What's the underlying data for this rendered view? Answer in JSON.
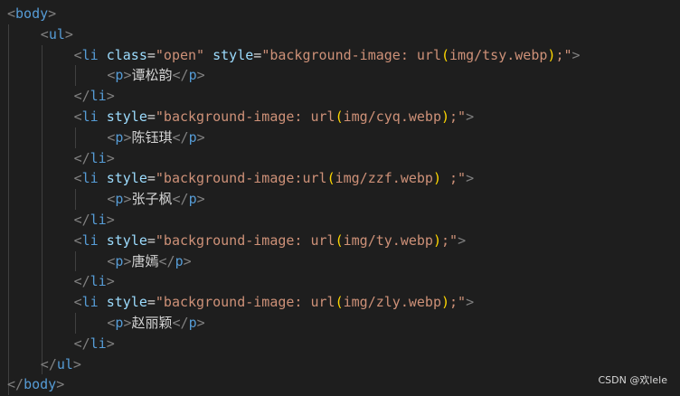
{
  "code": [
    {
      "indent": 0,
      "tokens": [
        [
          "punc",
          "<"
        ],
        [
          "tag",
          "body"
        ],
        [
          "punc",
          ">"
        ]
      ]
    },
    {
      "indent": 1,
      "tokens": [
        [
          "punc",
          "<"
        ],
        [
          "tag",
          "ul"
        ],
        [
          "punc",
          ">"
        ]
      ]
    },
    {
      "indent": 2,
      "tokens": [
        [
          "punc",
          "<"
        ],
        [
          "tag",
          "li"
        ],
        [
          "text",
          " "
        ],
        [
          "attr",
          "class"
        ],
        [
          "eq",
          "="
        ],
        [
          "str",
          "\"open\""
        ],
        [
          "text",
          " "
        ],
        [
          "attr",
          "style"
        ],
        [
          "eq",
          "="
        ],
        [
          "str",
          "\"background-image: url"
        ],
        [
          "brk",
          "("
        ],
        [
          "str",
          "img/tsy.webp"
        ],
        [
          "brk",
          ")"
        ],
        [
          "str",
          ";\""
        ],
        [
          "punc",
          ">"
        ]
      ]
    },
    {
      "indent": 3,
      "tokens": [
        [
          "punc",
          "<"
        ],
        [
          "tag",
          "p"
        ],
        [
          "punc",
          ">"
        ],
        [
          "text",
          "谭松韵"
        ],
        [
          "punc",
          "</"
        ],
        [
          "tag",
          "p"
        ],
        [
          "punc",
          ">"
        ]
      ]
    },
    {
      "indent": 2,
      "tokens": [
        [
          "punc",
          "</"
        ],
        [
          "tag",
          "li"
        ],
        [
          "punc",
          ">"
        ]
      ]
    },
    {
      "indent": 2,
      "tokens": [
        [
          "punc",
          "<"
        ],
        [
          "tag",
          "li"
        ],
        [
          "text",
          " "
        ],
        [
          "attr",
          "style"
        ],
        [
          "eq",
          "="
        ],
        [
          "str",
          "\"background-image: url"
        ],
        [
          "brk",
          "("
        ],
        [
          "str",
          "img/cyq.webp"
        ],
        [
          "brk",
          ")"
        ],
        [
          "str",
          ";\""
        ],
        [
          "punc",
          ">"
        ]
      ]
    },
    {
      "indent": 3,
      "tokens": [
        [
          "punc",
          "<"
        ],
        [
          "tag",
          "p"
        ],
        [
          "punc",
          ">"
        ],
        [
          "text",
          "陈钰琪"
        ],
        [
          "punc",
          "</"
        ],
        [
          "tag",
          "p"
        ],
        [
          "punc",
          ">"
        ]
      ]
    },
    {
      "indent": 2,
      "tokens": [
        [
          "punc",
          "</"
        ],
        [
          "tag",
          "li"
        ],
        [
          "punc",
          ">"
        ]
      ]
    },
    {
      "indent": 2,
      "tokens": [
        [
          "punc",
          "<"
        ],
        [
          "tag",
          "li"
        ],
        [
          "text",
          " "
        ],
        [
          "attr",
          "style"
        ],
        [
          "eq",
          "="
        ],
        [
          "str",
          "\"background-image:url"
        ],
        [
          "brk",
          "("
        ],
        [
          "str",
          "img/zzf.webp"
        ],
        [
          "brk",
          ")"
        ],
        [
          "str",
          " ;\""
        ],
        [
          "punc",
          ">"
        ]
      ]
    },
    {
      "indent": 3,
      "tokens": [
        [
          "punc",
          "<"
        ],
        [
          "tag",
          "p"
        ],
        [
          "punc",
          ">"
        ],
        [
          "text",
          "张子枫"
        ],
        [
          "punc",
          "</"
        ],
        [
          "tag",
          "p"
        ],
        [
          "punc",
          ">"
        ]
      ]
    },
    {
      "indent": 2,
      "tokens": [
        [
          "punc",
          "</"
        ],
        [
          "tag",
          "li"
        ],
        [
          "punc",
          ">"
        ]
      ]
    },
    {
      "indent": 2,
      "tokens": [
        [
          "punc",
          "<"
        ],
        [
          "tag",
          "li"
        ],
        [
          "text",
          " "
        ],
        [
          "attr",
          "style"
        ],
        [
          "eq",
          "="
        ],
        [
          "str",
          "\"background-image: url"
        ],
        [
          "brk",
          "("
        ],
        [
          "str",
          "img/ty.webp"
        ],
        [
          "brk",
          ")"
        ],
        [
          "str",
          ";\""
        ],
        [
          "punc",
          ">"
        ]
      ]
    },
    {
      "indent": 3,
      "tokens": [
        [
          "punc",
          "<"
        ],
        [
          "tag",
          "p"
        ],
        [
          "punc",
          ">"
        ],
        [
          "text",
          "唐嫣"
        ],
        [
          "punc",
          "</"
        ],
        [
          "tag",
          "p"
        ],
        [
          "punc",
          ">"
        ]
      ]
    },
    {
      "indent": 2,
      "tokens": [
        [
          "punc",
          "</"
        ],
        [
          "tag",
          "li"
        ],
        [
          "punc",
          ">"
        ]
      ]
    },
    {
      "indent": 2,
      "tokens": [
        [
          "punc",
          "<"
        ],
        [
          "tag",
          "li"
        ],
        [
          "text",
          " "
        ],
        [
          "attr",
          "style"
        ],
        [
          "eq",
          "="
        ],
        [
          "str",
          "\"background-image: url"
        ],
        [
          "brk",
          "("
        ],
        [
          "str",
          "img/zly.webp"
        ],
        [
          "brk",
          ")"
        ],
        [
          "str",
          ";\""
        ],
        [
          "punc",
          ">"
        ]
      ]
    },
    {
      "indent": 3,
      "tokens": [
        [
          "punc",
          "<"
        ],
        [
          "tag",
          "p"
        ],
        [
          "punc",
          ">"
        ],
        [
          "text",
          "赵丽颖"
        ],
        [
          "punc",
          "</"
        ],
        [
          "tag",
          "p"
        ],
        [
          "punc",
          ">"
        ]
      ]
    },
    {
      "indent": 2,
      "tokens": [
        [
          "punc",
          "</"
        ],
        [
          "tag",
          "li"
        ],
        [
          "punc",
          ">"
        ]
      ]
    },
    {
      "indent": 1,
      "tokens": [
        [
          "punc",
          "</"
        ],
        [
          "tag",
          "ul"
        ],
        [
          "punc",
          ">"
        ]
      ]
    },
    {
      "indent": 0,
      "tokens": [
        [
          "punc",
          "</"
        ],
        [
          "tag",
          "body"
        ],
        [
          "punc",
          ">"
        ]
      ]
    }
  ],
  "watermark": "CSDN @欢lele",
  "colors": {
    "background": "#1e1e1e",
    "punctuation": "#808080",
    "tag": "#569cd6",
    "attribute": "#9cdcfe",
    "string": "#ce9178",
    "bracket": "#ffd700",
    "text": "#d4d4d4"
  }
}
